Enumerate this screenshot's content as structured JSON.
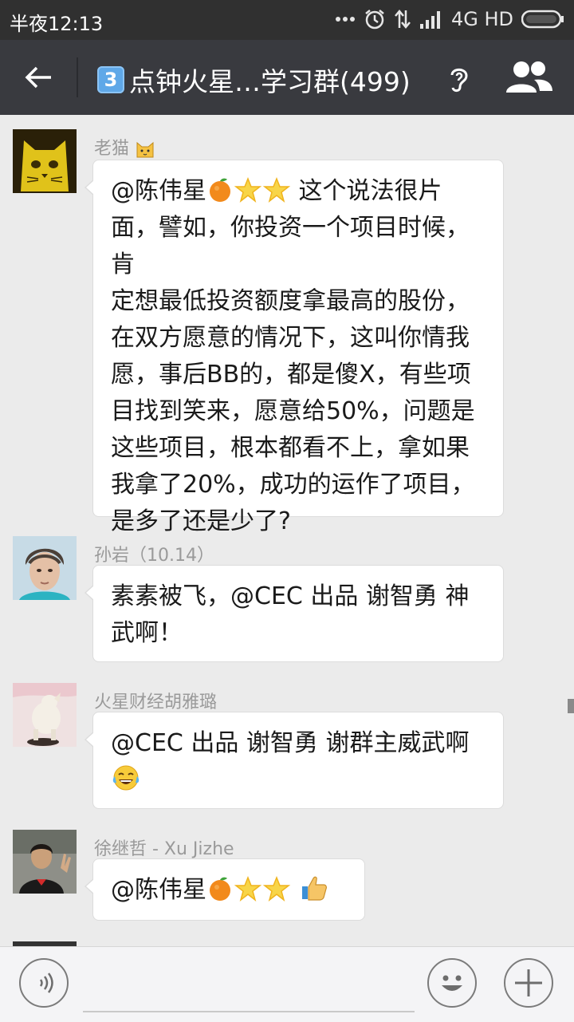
{
  "status_bar": {
    "time": "半夜12:13",
    "network": "4G HD",
    "icons": [
      "more-dots-icon",
      "alarm-icon",
      "data-arrows-icon",
      "signal-icon",
      "battery-icon"
    ]
  },
  "header": {
    "group_number_badge": "3",
    "title": "点钟火星…学习群(499)",
    "icons": [
      "back-arrow-icon",
      "ear-icon",
      "group-members-icon"
    ]
  },
  "messages": [
    {
      "sender": "老猫",
      "sender_emoji": "cat-face-icon",
      "lines": [
        "@陈伟星",
        "这个说法很片",
        "面，譬如，你投资一个项目时候，肯",
        "定想最低投资额度拿最高的股份，",
        "在双方愿意的情况下，这叫你情我",
        "愿，事后BB的，都是傻X，有些项",
        "目找到笑来，愿意给50%，问题是",
        "这些项目，根本都看不上，拿如果",
        "我拿了20%，成功的运作了项目，",
        "是多了还是少了?"
      ]
    },
    {
      "sender": "孙岩（10.14）",
      "lines": [
        "素素被飞，@CEC 出品 谢智勇 神",
        "武啊！"
      ]
    },
    {
      "sender": "火星财经胡雅璐",
      "lines": [
        "@CEC 出品 谢智勇 谢群主威武啊"
      ],
      "trailing_emoji": "laughing-tears-icon"
    },
    {
      "sender": "徐继哲 - Xu Jizhe",
      "lines": [
        "@陈伟星"
      ],
      "trailing_emoji": "thumbs-up-icon"
    }
  ],
  "input_bar": {
    "placeholder": "",
    "icons": [
      "voice-icon",
      "emoji-icon",
      "plus-icon"
    ]
  },
  "colors": {
    "status_bar_bg": "#303030",
    "nav_bar_bg": "#393a3f",
    "chat_bg": "#ebebeb",
    "bubble_bg": "#ffffff",
    "sender_name": "#9a9a9a"
  }
}
